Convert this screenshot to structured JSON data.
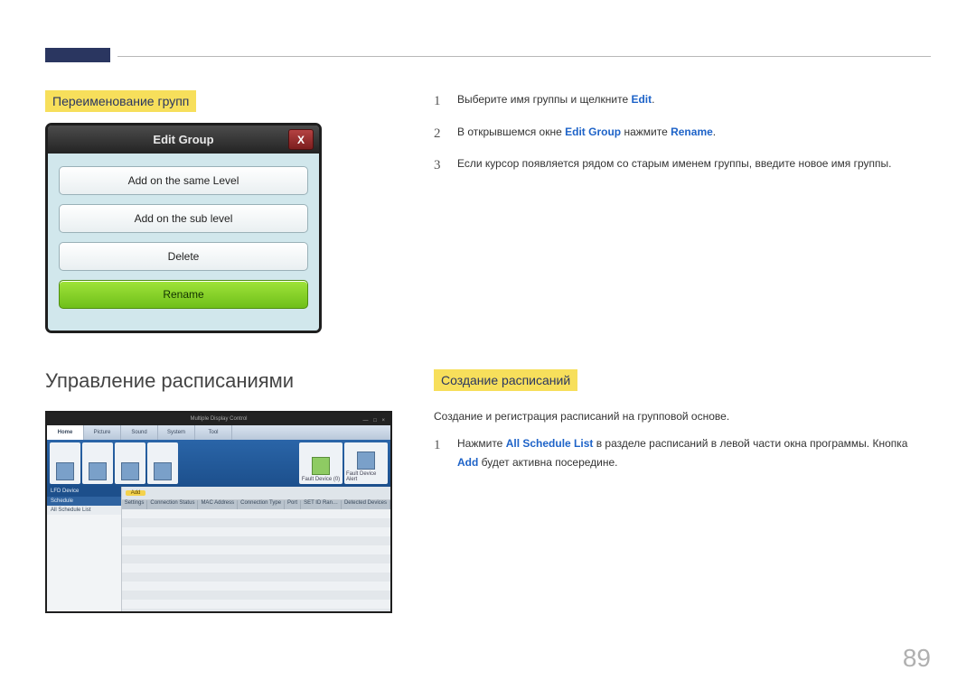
{
  "page_number": "89",
  "section1": {
    "title": "Переименование групп",
    "dialog": {
      "title": "Edit Group",
      "close_label": "X",
      "buttons": {
        "same_level": "Add on the same Level",
        "sub_level": "Add on the sub level",
        "delete": "Delete",
        "rename": "Rename"
      }
    },
    "steps": {
      "s1": {
        "n": "1",
        "pre": "Выберите имя группы и щелкните ",
        "link1": "Edit",
        "post": "."
      },
      "s2": {
        "n": "2",
        "pre": "В открывшемся окне ",
        "link1": "Edit Group",
        "mid": " нажмите ",
        "link2": "Rename",
        "post": "."
      },
      "s3": {
        "n": "3",
        "text": "Если курсор появляется рядом со старым именем группы, введите новое имя группы."
      }
    }
  },
  "section2": {
    "heading": "Управление расписаниями",
    "title": "Создание расписаний",
    "intro": "Создание и регистрация расписаний на групповой основе.",
    "step": {
      "n": "1",
      "pre": "Нажмите ",
      "link1": "All Schedule List",
      "mid": " в разделе расписаний в левой части окна программы. Кнопка ",
      "link2": "Add",
      "post": " будет активна посередине."
    },
    "mdc": {
      "title": "Multiple Display Control",
      "win_controls": "— □ ×",
      "tabs": [
        "Home",
        "Picture",
        "Sound",
        "System",
        "Tool"
      ],
      "ribbon": {
        "fault_device": "Fault Device (0)",
        "fault_alert": "Fault Device Alert"
      },
      "side": {
        "lfd": "LFD Device",
        "schedule": "Schedule",
        "all_list": "All Schedule List"
      },
      "toolbar": {
        "add": "Add"
      },
      "columns": [
        "Settings",
        "Connection Status",
        "MAC Address",
        "Connection Type",
        "Port",
        "SET ID Ran…",
        "Detected Devices"
      ]
    }
  }
}
